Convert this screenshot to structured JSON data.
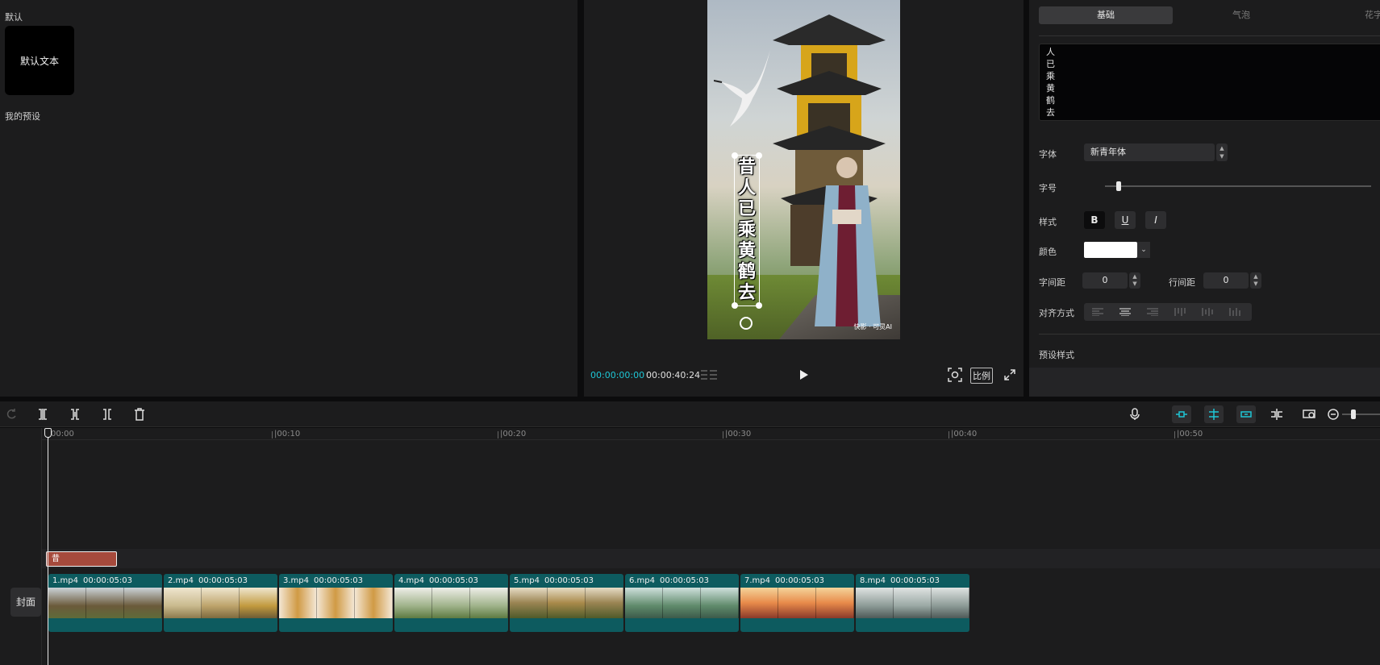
{
  "left_panel": {
    "section_default": "默认",
    "preset_default_text": "默认文本",
    "section_my_presets": "我的预设"
  },
  "player": {
    "subtitle_text": "昔人已乘黄鹤去",
    "watermark": "快影 · 可灵AI",
    "time_current": "00:00:00:00",
    "time_total": "00:00:40:24",
    "ratio_label": "比例"
  },
  "inspector": {
    "tabs": [
      "基础",
      "气泡",
      "花字"
    ],
    "text_content": "人已乘黄鹤去",
    "font_label": "字体",
    "font_value": "新青年体",
    "size_label": "字号",
    "size_level": 0.05,
    "style_label": "样式",
    "bold": "B",
    "underline": "U",
    "italic": "I",
    "color_label": "颜色",
    "color_value": "#ffffff",
    "letter_spacing_label": "字间距",
    "letter_spacing_value": "0",
    "line_spacing_label": "行间距",
    "line_spacing_value": "0",
    "align_label": "对齐方式",
    "preset_style_label": "预设样式"
  },
  "timeline": {
    "ticks": [
      "00:00",
      "|00:10",
      "|00:20",
      "|00:30",
      "|00:40",
      "|00:50"
    ],
    "cover_label": "封面",
    "text_clip_label": "昔",
    "clips": [
      {
        "name": "1.mp4",
        "duration": "00:00:05:03"
      },
      {
        "name": "2.mp4",
        "duration": "00:00:05:03"
      },
      {
        "name": "3.mp4",
        "duration": "00:00:05:03"
      },
      {
        "name": "4.mp4",
        "duration": "00:00:05:03"
      },
      {
        "name": "5.mp4",
        "duration": "00:00:05:03"
      },
      {
        "name": "6.mp4",
        "duration": "00:00:05:03"
      },
      {
        "name": "7.mp4",
        "duration": "00:00:05:03"
      },
      {
        "name": "8.mp4",
        "duration": "00:00:05:03"
      }
    ]
  },
  "colors": {
    "accent": "#1ec6d6",
    "clip_bg": "#0d5b5f",
    "text_clip": "#a64a3c"
  }
}
